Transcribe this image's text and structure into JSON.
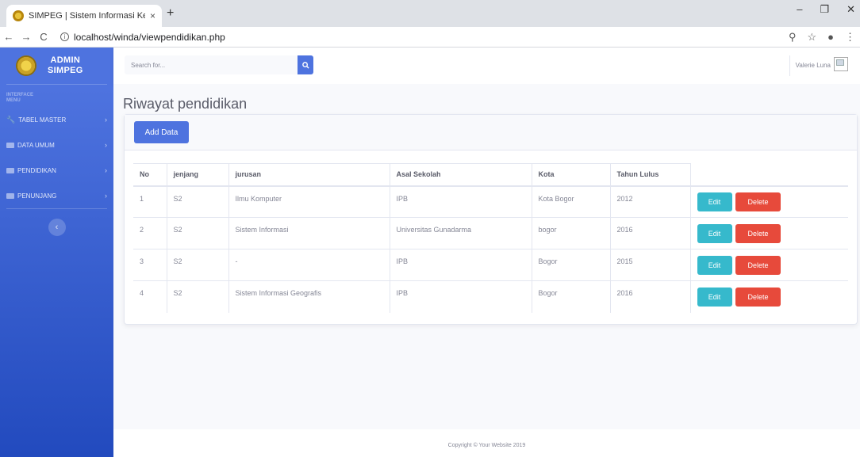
{
  "browser": {
    "tab_title": "SIMPEG | Sistem Informasi Kepeg",
    "tab_close": "×",
    "new_tab": "+",
    "url": "localhost/winda/viewpendidikan.php",
    "window_controls": [
      "–",
      "❐",
      "✕"
    ],
    "nav": {
      "back": "←",
      "forward": "→",
      "reload": "C"
    },
    "right_icons": [
      "⚲",
      "☆",
      "●",
      "⋮"
    ]
  },
  "sidebar": {
    "brand_line1": "ADMIN",
    "brand_line2": "SIMPEG",
    "heading_line1": "INTERFACE",
    "heading_line2": "MENU",
    "items": [
      {
        "label": "TABEL MASTER",
        "icon": "wrench-icon"
      },
      {
        "label": "DATA UMUM",
        "icon": "folder-icon"
      },
      {
        "label": "PENDIDIKAN",
        "icon": "folder-icon"
      },
      {
        "label": "PENUNJANG",
        "icon": "folder-icon"
      }
    ],
    "chevron": "›",
    "toggle": "‹"
  },
  "topbar": {
    "search_placeholder": "Search for...",
    "user_name": "Valerie Luna"
  },
  "main": {
    "page_title": "Riwayat pendidikan",
    "add_button": "Add Data",
    "table": {
      "headers": [
        "No",
        "jenjang",
        "jurusan",
        "Asal Sekolah",
        "Kota",
        "Tahun Lulus"
      ],
      "rows": [
        [
          "1",
          "S2",
          "Ilmu Komputer",
          "IPB",
          "Kota Bogor",
          "2012"
        ],
        [
          "2",
          "S2",
          "Sistem Informasi",
          "Universitas Gunadarma",
          "bogor",
          "2016"
        ],
        [
          "3",
          "S2",
          "-",
          "IPB",
          "Bogor",
          "2015"
        ],
        [
          "4",
          "S2",
          "Sistem Informasi Geografis",
          "IPB",
          "Bogor",
          "2016"
        ]
      ],
      "edit_label": "Edit",
      "delete_label": "Delete"
    }
  },
  "footer": {
    "text": "Copyright © Your Website 2019"
  },
  "colors": {
    "primary": "#4e73df",
    "info": "#36b9cc",
    "danger": "#e74a3b"
  }
}
